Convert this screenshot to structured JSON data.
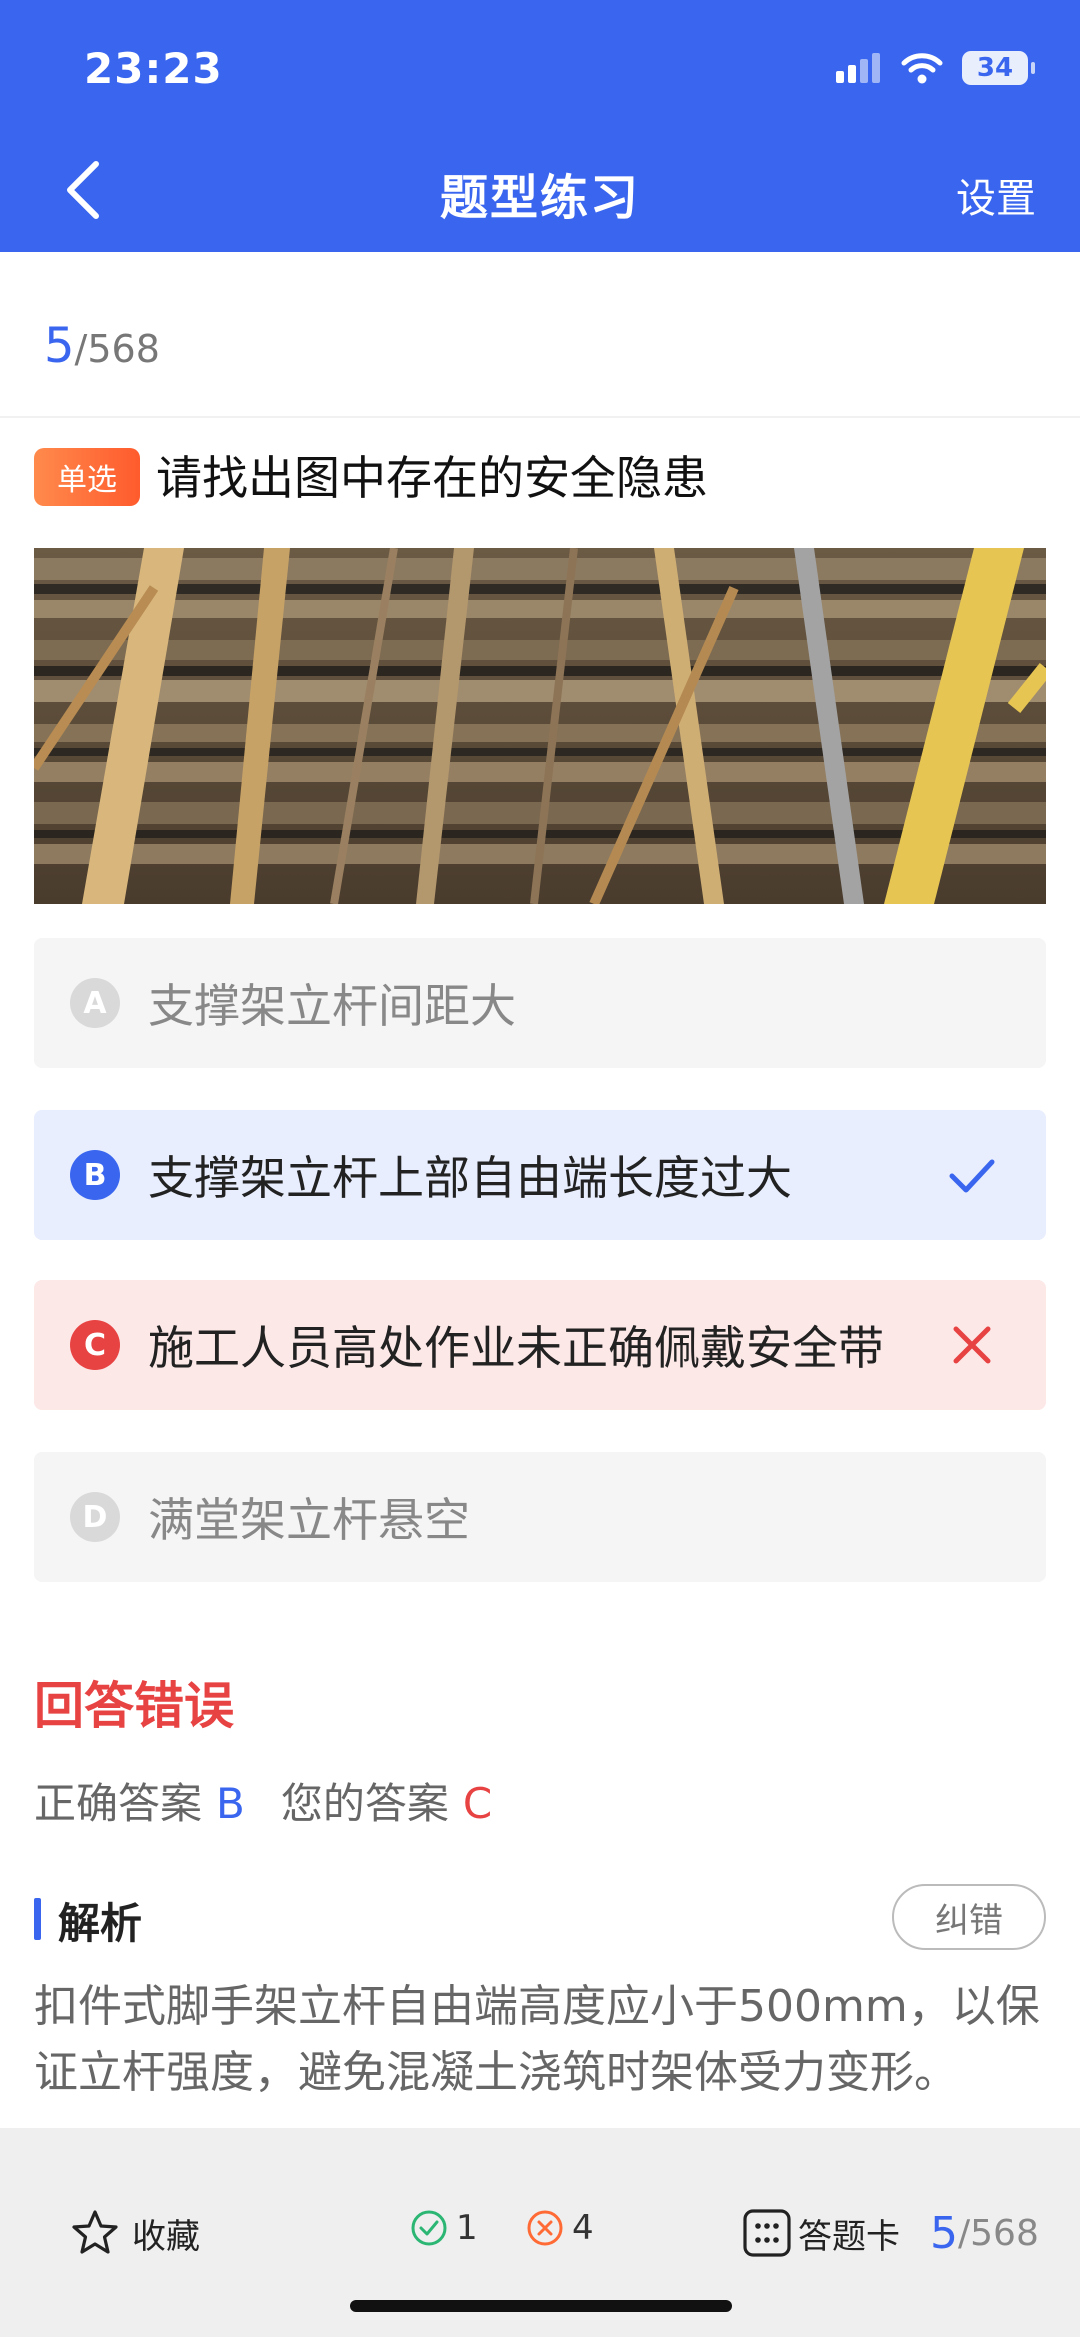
{
  "status": {
    "time": "23:23",
    "battery": "34"
  },
  "header": {
    "title": "题型练习",
    "settings_label": "设置"
  },
  "progress": {
    "current": "5",
    "total": "/568"
  },
  "question": {
    "type_label": "单选",
    "text": "请找出图中存在的安全隐患"
  },
  "options": [
    {
      "letter": "A",
      "text": "支撑架立杆间距大",
      "state": "normal"
    },
    {
      "letter": "B",
      "text": "支撑架立杆上部自由端长度过大",
      "state": "correct"
    },
    {
      "letter": "C",
      "text": "施工人员高处作业未正确佩戴安全带",
      "state": "wrong"
    },
    {
      "letter": "D",
      "text": "满堂架立杆悬空",
      "state": "normal"
    }
  ],
  "result": {
    "title": "回答错误",
    "correct_label": "正确答案",
    "correct_value": "B",
    "yours_label": "您的答案",
    "yours_value": "C"
  },
  "analysis": {
    "title": "解析",
    "report_label": "纠错",
    "text": "扣件式脚手架立杆自由端高度应小于500mm，以保证立杆强度，避免混凝土浇筑时架体受力变形。"
  },
  "bottom": {
    "collect_label": "收藏",
    "right_count": "1",
    "wrong_count": "4",
    "card_label": "答题卡",
    "progress_current": "5",
    "progress_total": "/568"
  },
  "colors": {
    "accent": "#3a66ef",
    "error": "#e84343",
    "success": "#2bb673",
    "badge": "#ff6a35"
  }
}
